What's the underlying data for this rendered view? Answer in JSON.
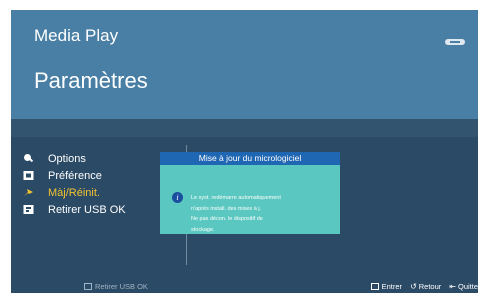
{
  "header": {
    "app_title": "Media Play",
    "page_title": "Paramètres"
  },
  "menu": {
    "items": [
      {
        "label": "Options",
        "icon": "gear-icon"
      },
      {
        "label": "Préférence",
        "icon": "settings-box-icon"
      },
      {
        "label": "Màj/Réinit.",
        "icon": "update-arrow-icon",
        "selected": true
      },
      {
        "label": "Retirer USB OK",
        "icon": "usb-icon"
      }
    ]
  },
  "dialog": {
    "title": "Mise à jour du micrologiciel",
    "lines": [
      "Le syst. redémarre automatiquement",
      "n'après install. des mises à j.",
      "Ne pas décon. le dispositif de",
      "stockage."
    ]
  },
  "footer": {
    "left_label": "Retirer USB OK",
    "enter_label": "Entrer",
    "return_label": "Retour",
    "quit_label": "Quitte"
  },
  "colors": {
    "header_bg": "#4a7fa5",
    "screen_bg": "#2b4a66",
    "dialog_bg": "#5ac7c0",
    "dialog_title_bg": "#1f66b3",
    "selected_text": "#f2c230"
  }
}
